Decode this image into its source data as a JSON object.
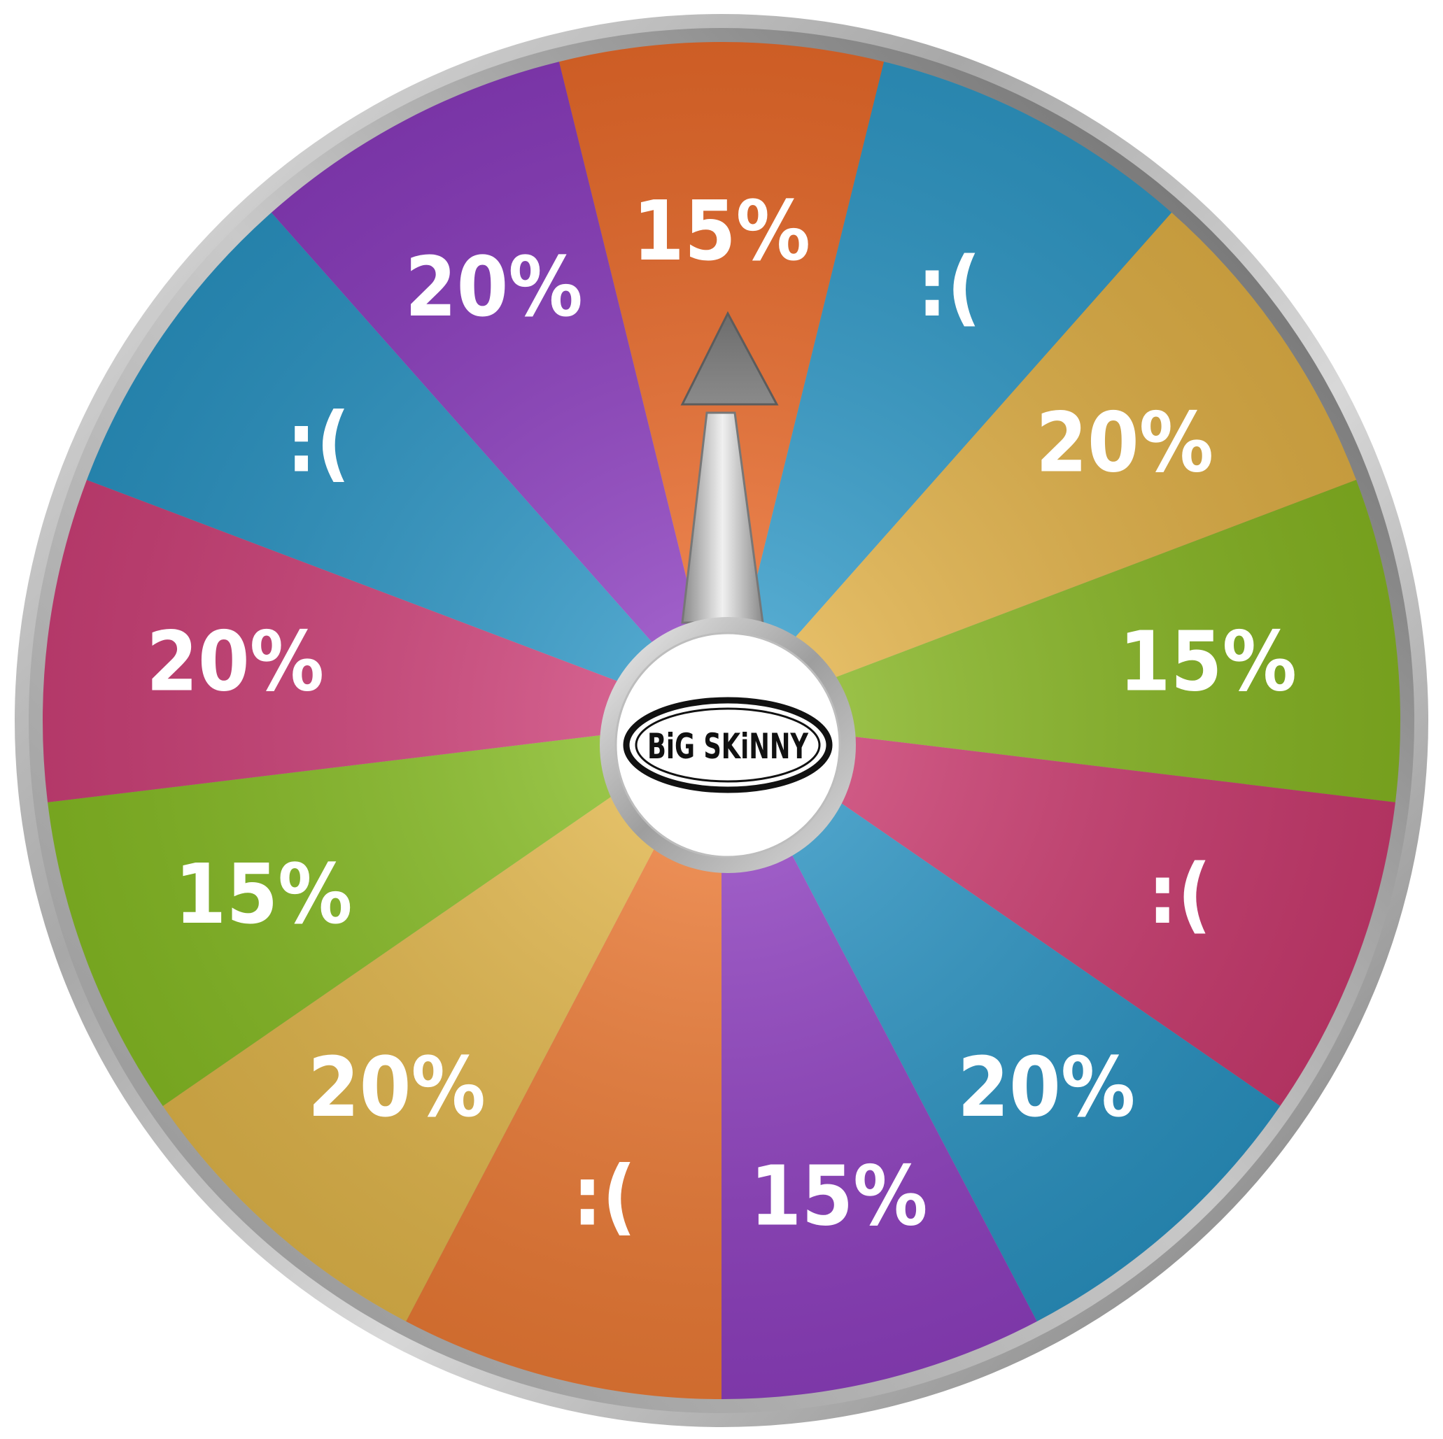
{
  "wheel": {
    "segments": [
      {
        "label": "15%",
        "color": "#e96a2a"
      },
      {
        "label": ":(",
        "color": "#2f98c6"
      },
      {
        "label": "20%",
        "color": "#e0b046"
      },
      {
        "label": "15%",
        "color": "#86b522"
      },
      {
        "label": ":(",
        "color": "#c93a6e"
      },
      {
        "label": "20%",
        "color": "#2a92c1"
      },
      {
        "label": "15%",
        "color": "#8e3fbf"
      },
      {
        "label": ":(",
        "color": "#eb7a35"
      },
      {
        "label": "20%",
        "color": "#e0b54a"
      },
      {
        "label": "15%",
        "color": "#86bb24"
      },
      {
        "label": "20%",
        "color": "#cc4077"
      },
      {
        "label": ":(",
        "color": "#2a93c2"
      },
      {
        "label": "20%",
        "color": "#8a3cbd"
      }
    ],
    "pointer_color": "#7d7d7d",
    "rim_color": "#9a9a9a"
  },
  "logo": {
    "text": "BiG SKiNNY"
  }
}
